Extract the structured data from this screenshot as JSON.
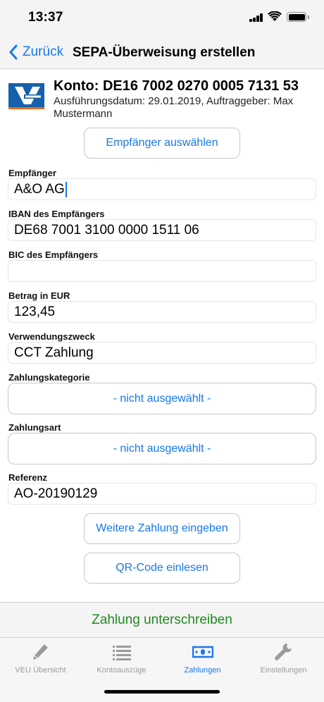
{
  "status_bar": {
    "time": "13:37"
  },
  "nav": {
    "back_label": "Zurück",
    "title": "SEPA-Überweisung erstellen"
  },
  "account": {
    "title": "Konto: DE16 7002 0270 0005 7131 53",
    "subtitle": "Ausführungsdatum: 29.01.2019, Auftraggeber: Max Mustermann"
  },
  "buttons": {
    "select_recipient": "Empfänger auswählen",
    "more_payment": "Weitere Zahlung eingeben",
    "scan_qr": "QR-Code einlesen",
    "sign": "Zahlung unterschreiben"
  },
  "form": {
    "recipient": {
      "label": "Empfänger",
      "value": "A&O AG"
    },
    "iban": {
      "label": "IBAN des Empfängers",
      "value": "DE68 7001 3100 0000 1511 06"
    },
    "bic": {
      "label": "BIC des Empfängers",
      "value": ""
    },
    "amount": {
      "label": "Betrag in EUR",
      "value": "123,45"
    },
    "purpose": {
      "label": "Verwendungszweck",
      "value": "CCT Zahlung"
    },
    "category": {
      "label": "Zahlungskategorie",
      "value": "- nicht ausgewählt -"
    },
    "payment_type": {
      "label": "Zahlungsart",
      "value": "- nicht ausgewählt -"
    },
    "reference": {
      "label": "Referenz",
      "value": "AO-20190129"
    }
  },
  "tabs": [
    {
      "label": "VEU Übersicht",
      "icon": "pencil-icon",
      "active": false
    },
    {
      "label": "Kontoauszüge",
      "icon": "list-icon",
      "active": false
    },
    {
      "label": "Zahlungen",
      "icon": "banknote-icon",
      "active": true
    },
    {
      "label": "Einstellungen",
      "icon": "wrench-icon",
      "active": false
    }
  ],
  "colors": {
    "accent": "#1878e8",
    "sign_green": "#1e8a1e",
    "brand_blue": "#1661ac",
    "brand_orange": "#f06a1a"
  }
}
